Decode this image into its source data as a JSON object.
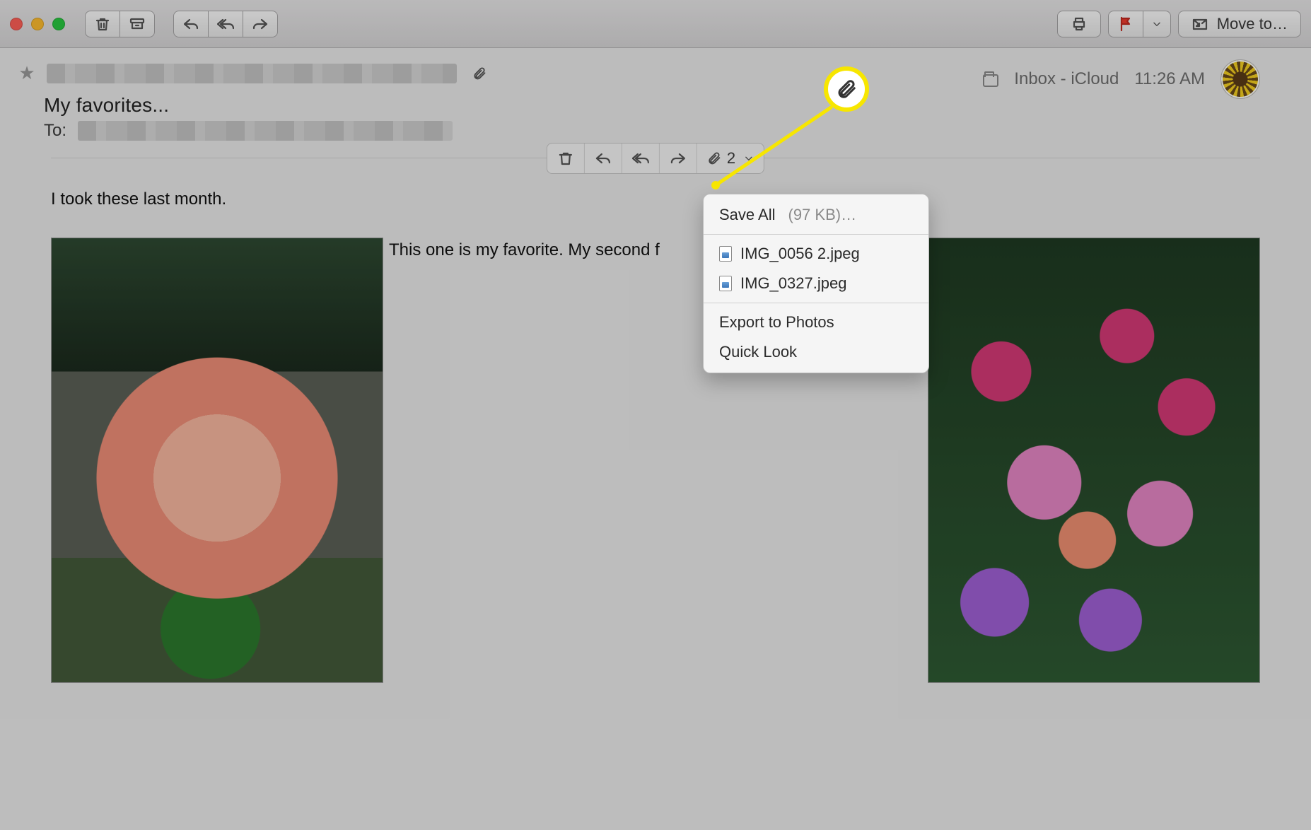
{
  "toolbar": {
    "move_to_label": "Move to…"
  },
  "header": {
    "subject": "My favorites...",
    "to_label": "To:",
    "mailbox_label": "Inbox - iCloud",
    "time": "11:26 AM"
  },
  "inline_toolbar": {
    "attachment_count": "2"
  },
  "attachment_menu": {
    "save_all_label": "Save All",
    "save_all_size": "(97 KB)…",
    "files": [
      {
        "name": "IMG_0056 2.jpeg"
      },
      {
        "name": "IMG_0327.jpeg"
      }
    ],
    "export_label": "Export to Photos",
    "quicklook_label": "Quick Look"
  },
  "body": {
    "intro": "I took these last month.",
    "middle_line": "This one is my favorite. My second f"
  }
}
